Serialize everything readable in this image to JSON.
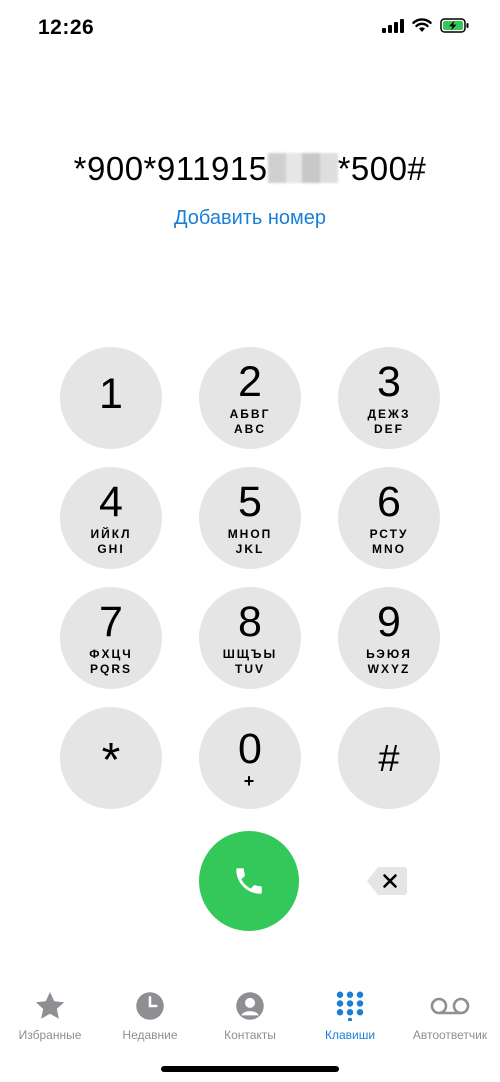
{
  "status": {
    "time": "12:26"
  },
  "dialer": {
    "number_part1": "*900*911915",
    "number_part2": "*500#",
    "add_number": "Добавить номер"
  },
  "keys": [
    {
      "digit": "1",
      "letters": "",
      "latin": ""
    },
    {
      "digit": "2",
      "letters": "АБВГ",
      "latin": "ABC"
    },
    {
      "digit": "3",
      "letters": "ДЕЖЗ",
      "latin": "DEF"
    },
    {
      "digit": "4",
      "letters": "ИЙКЛ",
      "latin": "GHI"
    },
    {
      "digit": "5",
      "letters": "МНОП",
      "latin": "JKL"
    },
    {
      "digit": "6",
      "letters": "РСТУ",
      "latin": "MNO"
    },
    {
      "digit": "7",
      "letters": "ФХЦЧ",
      "latin": "PQRS"
    },
    {
      "digit": "8",
      "letters": "ШЩЪЫ",
      "latin": "TUV"
    },
    {
      "digit": "9",
      "letters": "ЬЭЮЯ",
      "latin": "WXYZ"
    },
    {
      "digit": "*",
      "letters": "",
      "latin": ""
    },
    {
      "digit": "0",
      "letters": "+",
      "latin": ""
    },
    {
      "digit": "#",
      "letters": "",
      "latin": ""
    }
  ],
  "tabs": [
    {
      "label": "Избранные",
      "icon": "star-icon",
      "active": false
    },
    {
      "label": "Недавние",
      "icon": "clock-icon",
      "active": false
    },
    {
      "label": "Контакты",
      "icon": "person-icon",
      "active": false
    },
    {
      "label": "Клавиши",
      "icon": "keypad-icon",
      "active": true
    },
    {
      "label": "Автоответчик",
      "icon": "voicemail-icon",
      "active": false
    }
  ],
  "colors": {
    "accent": "#1a7fd8",
    "call": "#34c759",
    "key_bg": "#e5e5e5",
    "inactive": "#8e8e93",
    "battery": "#34c759"
  }
}
